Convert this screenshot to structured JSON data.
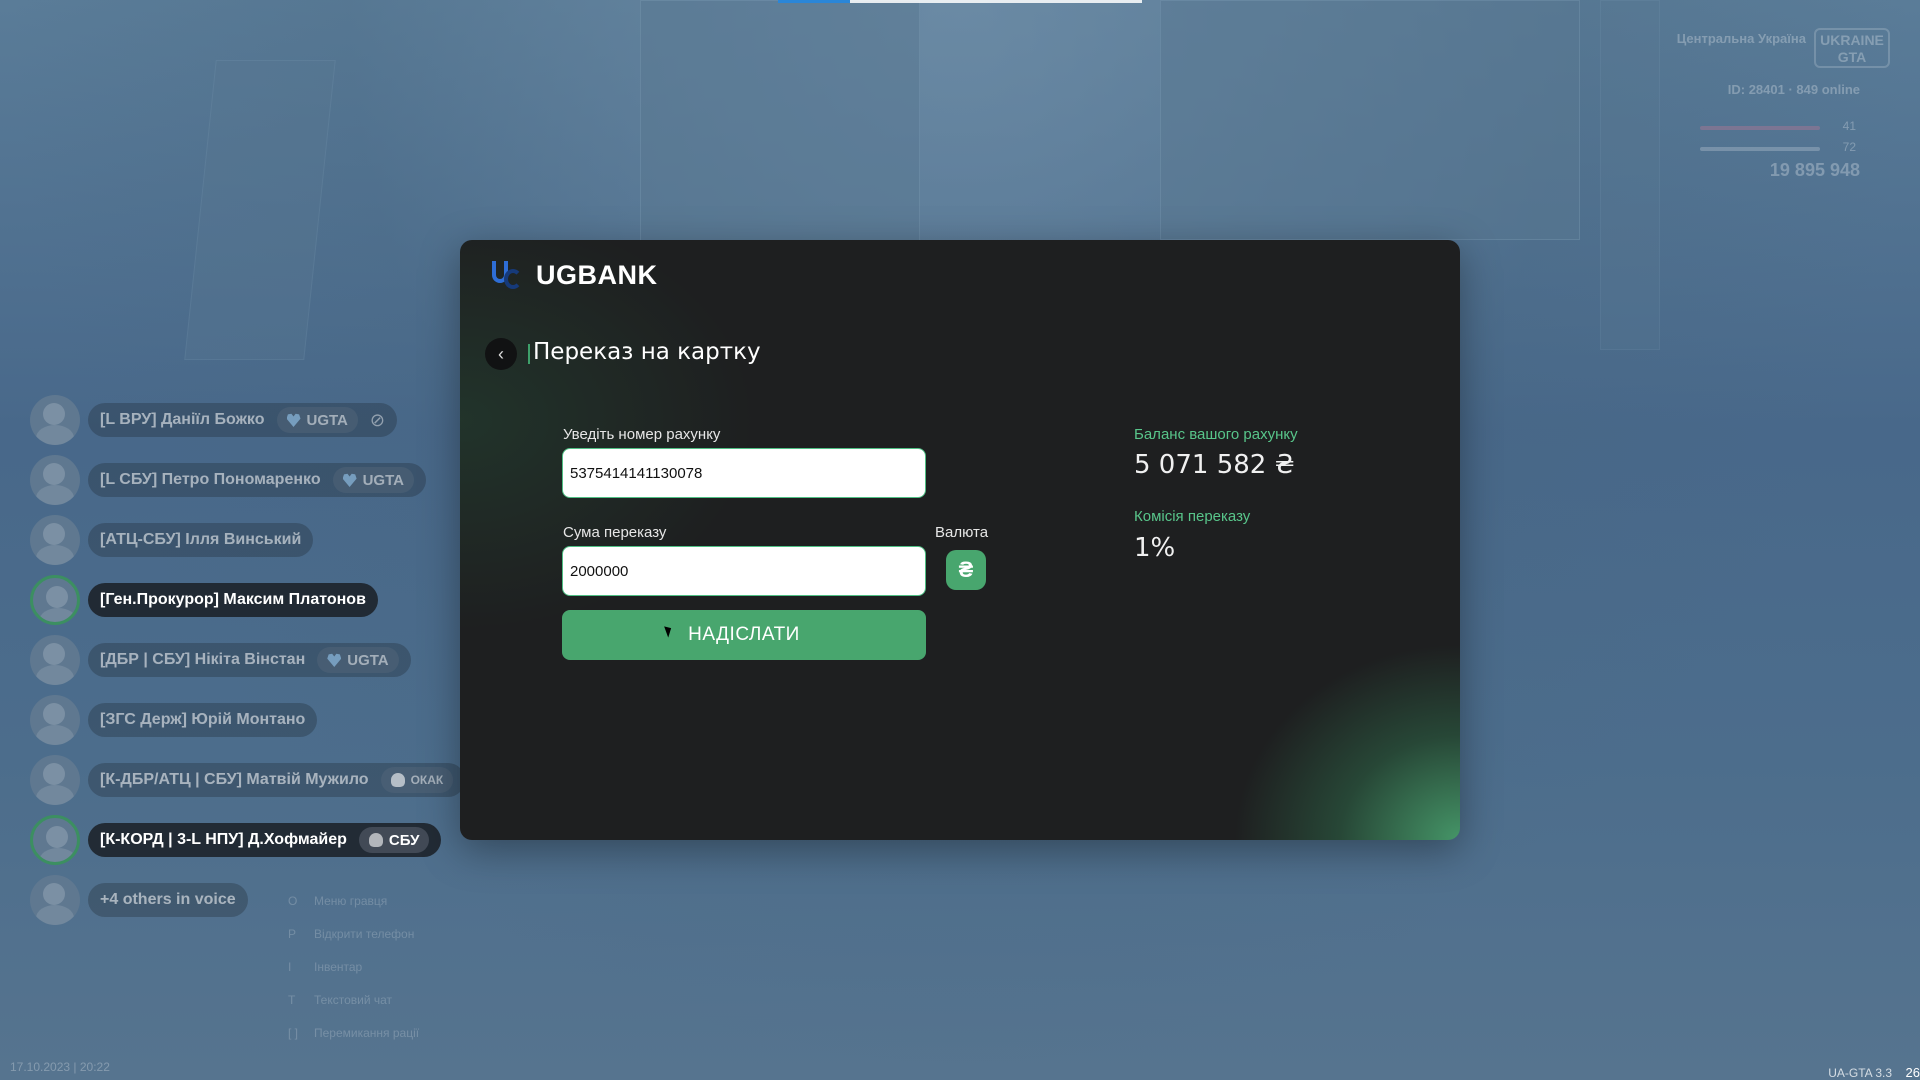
{
  "hud": {
    "region": "Центральна Україна",
    "logo_text": "UKRAINE GTA",
    "ids": "ID: 28401 · 849 online",
    "stat1": "41",
    "stat2": "72",
    "money": "19 895 948"
  },
  "voice": {
    "members": [
      {
        "name": "[L ВРУ] Даніїл Божко",
        "tag": "UGTA",
        "tag_icon": "heart-icon",
        "muted": true,
        "active": false
      },
      {
        "name": "[L СБУ] Петро Пономаренко",
        "tag": "UGTA",
        "tag_icon": "heart-icon",
        "active": false
      },
      {
        "name": "[АТЦ-СБУ] Ілля Винський",
        "active": false
      },
      {
        "name": "[Ген.Прокурор] Максим Платонов",
        "active": true
      },
      {
        "name": "[ДБР | СБУ] Нікіта Вінстан",
        "tag": "UGTA",
        "tag_icon": "heart-icon",
        "active": false
      },
      {
        "name": "[ЗГС Держ] Юрій Монтано",
        "active": false
      },
      {
        "name": "[К-ДБР/АТЦ | СБУ] Матвій Мужило",
        "tag": "ОКАК",
        "tag_icon": "skull-icon",
        "active": false
      },
      {
        "name": "[К-КОРД | 3-L НПУ] Д.Хофмайер",
        "tag": "СБУ",
        "tag_icon": "skull-icon",
        "active": true
      }
    ],
    "others": "+4 others in voice"
  },
  "keys": [
    {
      "key": "O",
      "label": "Меню гравця"
    },
    {
      "key": "P",
      "label": "Відкрити телефон"
    },
    {
      "key": "I",
      "label": "Інвентар"
    },
    {
      "key": "T",
      "label": "Текстовий чат"
    },
    {
      "key": "[  ]",
      "label": "Перемикання рації"
    }
  ],
  "datetime": "17.10.2023 | 20:22",
  "version": "UA-GTA 3.3",
  "corner": "26",
  "bank": {
    "brand": "UGBANK",
    "title": "Переказ на картку",
    "account_label": "Уведіть номер рахунку",
    "account_value": "5375414141130078",
    "amount_label": "Сума переказу",
    "amount_value": "2000000",
    "currency_label": "Валюта",
    "currency_symbol": "₴",
    "send_label": "НАДІСЛАТИ",
    "balance_label": "Баланс вашого рахунку",
    "balance_value": "5 071 582 ₴",
    "commission_label": "Комісія переказу",
    "commission_value": "1%"
  },
  "colors": {
    "accent": "#48a66e",
    "accent_text": "#58c58a",
    "modal_bg": "#1e1f20",
    "brand_blue": "#2e6ed6"
  }
}
